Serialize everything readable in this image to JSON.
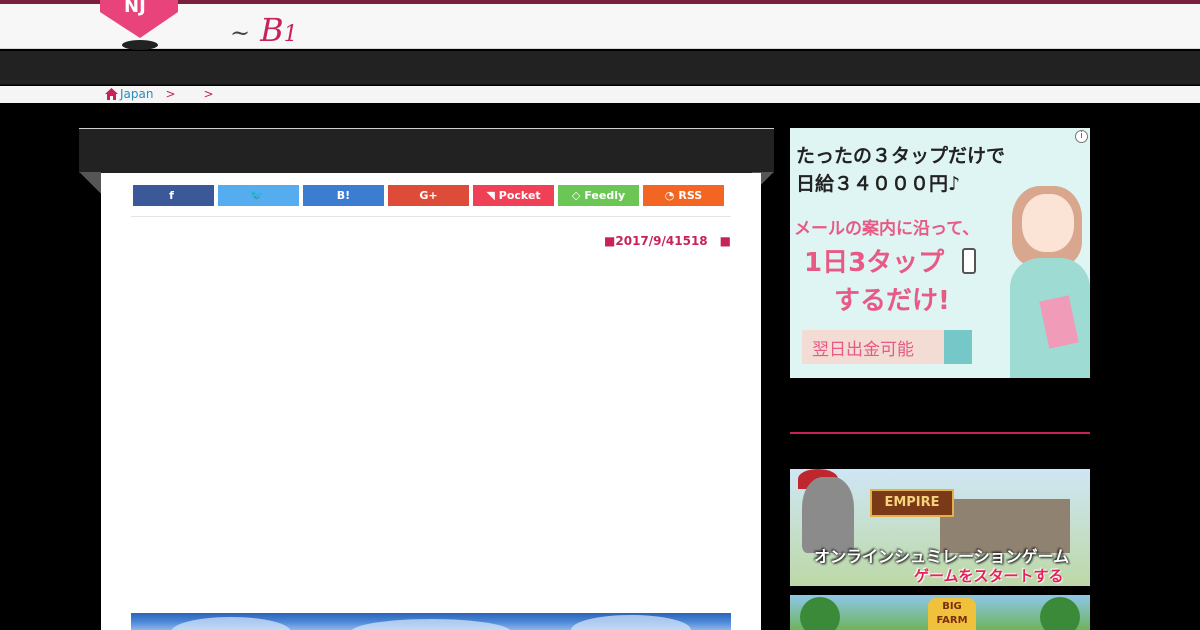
{
  "header": {
    "tagline_tilde": "~",
    "tagline_text": "B",
    "tagline_small": "1"
  },
  "breadcrumb": {
    "home_label": "Japan",
    "sep1": ">",
    "sep2": ">"
  },
  "share_buttons": [
    {
      "label": "",
      "icon": "f",
      "color": "#3b5998",
      "icon_name": "facebook-icon"
    },
    {
      "label": "",
      "icon": "🐦",
      "color": "#55acee",
      "icon_name": "twitter-icon"
    },
    {
      "label": "B!",
      "icon": "",
      "color": "#3c7dd1",
      "icon_name": "hatena-icon"
    },
    {
      "label": "G+",
      "icon": "",
      "color": "#dd4b39",
      "icon_name": "google-plus-icon"
    },
    {
      "label": "Pocket",
      "icon": "◥",
      "color": "#ef4056",
      "icon_name": "pocket-icon"
    },
    {
      "label": "Feedly",
      "icon": "◇",
      "color": "#6cc655",
      "icon_name": "feedly-icon"
    },
    {
      "label": "RSS",
      "icon": "◔",
      "color": "#f26522",
      "icon_name": "rss-icon"
    }
  ],
  "article": {
    "date": "■2017/9/41518　■"
  },
  "ads": {
    "ad1": {
      "info": "i",
      "line1": "たったの３タップだけで",
      "line2": "日給３４０００円♪",
      "pink1": "メールの案内に沿って、",
      "pink2": "1日3タップ",
      "pink3": "するだけ!",
      "pill": "翌日出金可能"
    },
    "ad2": {
      "logo": "EMPIRE",
      "line1": "オンラインシュミレーションゲーム",
      "line2": "ゲームをスタートする"
    },
    "ad3": {
      "logo": "BIG FARM"
    }
  },
  "colors": {
    "accent": "#c7235a",
    "link": "#2a8db8"
  }
}
